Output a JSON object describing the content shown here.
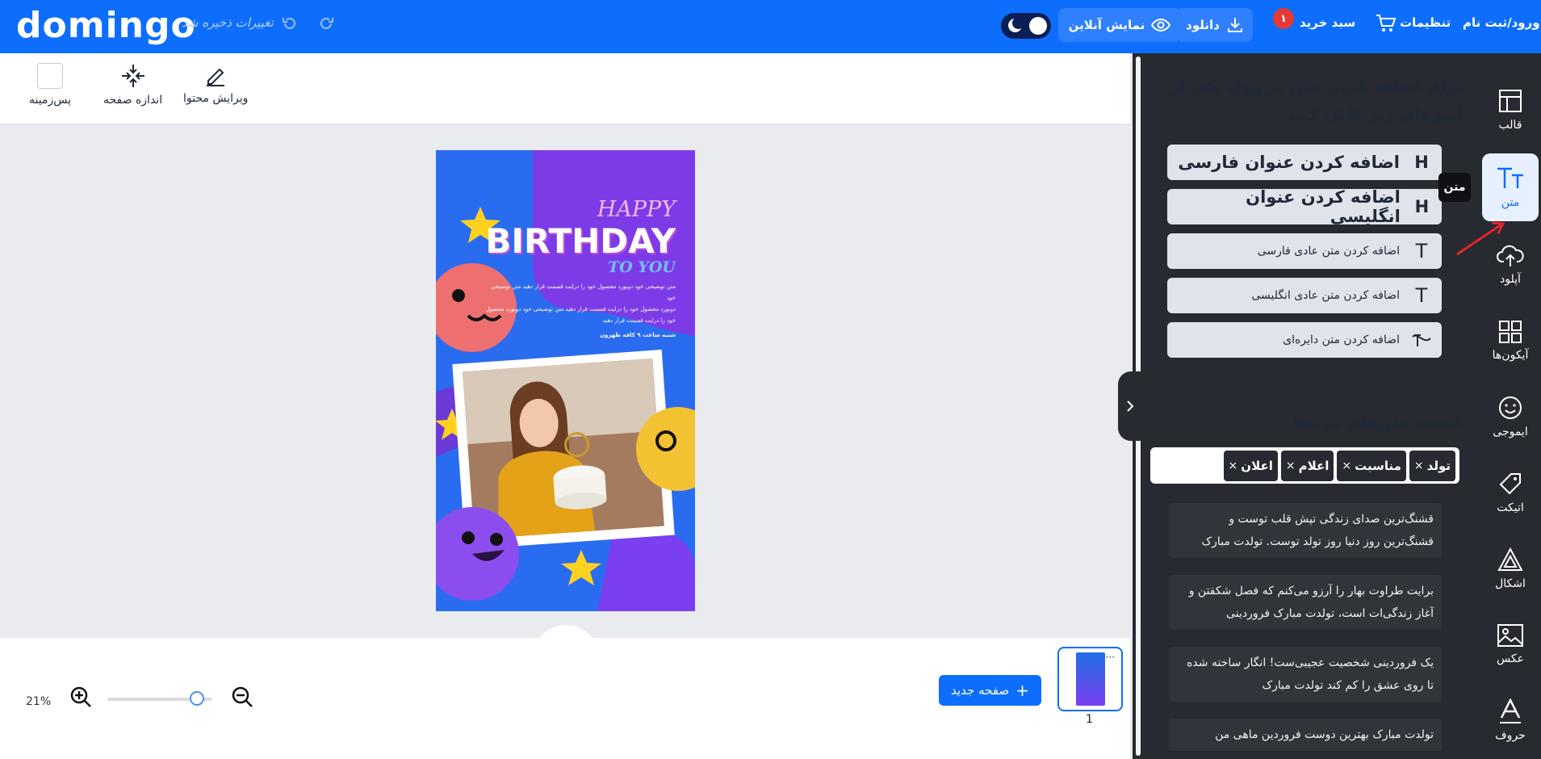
{
  "header": {
    "logo": "domingo",
    "saved_status": "تغییرات ذخیره شد",
    "preview_label": "نمایش آنلاین",
    "download_label": "دانلود",
    "cart_label": "سبد خرید",
    "cart_count": "۱",
    "settings_label": "تنظیمات",
    "login_label": "ورود/ثبت نام"
  },
  "tools": {
    "edit_content": "ویرایش محتوا",
    "page_size": "اندازه صفحه",
    "background": "پس‌زمینه"
  },
  "poster": {
    "happy": "HAPPY",
    "birthday": "BIRTHDAY",
    "to_you": "TO YOU",
    "body_lines": [
      "متن توضیحی خود دوبورد محصول خود را درایت قسمت قرار دهید متن توضیحی خود",
      "دوبورد محصول خود را درایت قسمت قرار دهید متن توضیحی خود دوبورد محصول",
      "خود را درایت قسمت قرار دهید"
    ],
    "footer_line": "شنبه ساعت ۹ کافه ظهرون"
  },
  "bottom": {
    "zoom": "21%",
    "zoom_level": 0.85,
    "new_page_label": "صفحه جدید",
    "page_number": "1"
  },
  "panel": {
    "instruction": "برای اضافه کردن متن بر روی یکی از آیتم‌های زیر کلیک کنید",
    "add_buttons": [
      {
        "label": "اضافه کردن عنوان فارسی",
        "icon": "heading-icon"
      },
      {
        "label": "اضافه کردن عنوان انگلیسی",
        "icon": "heading-icon"
      },
      {
        "label": "اضافه کردن متن عادی فارسی",
        "icon": "text-icon"
      },
      {
        "label": "اضافه کردن متن عادی انگلیسی",
        "icon": "text-icon"
      },
      {
        "label": "اضافه کردن متن دایره‌ای",
        "icon": "curve-text-icon"
      }
    ],
    "related_title": "لیست متن‌های مرتبط",
    "tags": [
      "تولد",
      "مناسبت",
      "اعلام",
      "اعلان"
    ],
    "snippets": [
      "قشنگ‌ترین صدای زندگی تپش قلب توست و قشنگ‌ترین روز دنیا روز تولد توست. تولدت مبارک",
      "برایت طراوت بهار را آرزو می‌کنم که فصل شکفتن و آغاز زندگی‌ات است، تولدت مبارک فروردینی",
      "یک فروردینی شخصیت عجیبی‌ست! انگار ساخته شده تا روی عشق را کم کند تولدت مبارک",
      "تولدت مبارک بهترین دوست فروردین ماهی من"
    ]
  },
  "rail": {
    "items": [
      {
        "label": "قالب",
        "icon": "template-icon"
      },
      {
        "label": "متن",
        "icon": "text-tt-icon"
      },
      {
        "label": "آپلود",
        "icon": "upload-icon"
      },
      {
        "label": "آیکون‌ها",
        "icon": "grid-icon"
      },
      {
        "label": "ایموجی",
        "icon": "smile-icon"
      },
      {
        "label": "اتیکت",
        "icon": "tag-icon"
      },
      {
        "label": "اشکال",
        "icon": "shapes-icon"
      },
      {
        "label": "عکس",
        "icon": "image-icon"
      },
      {
        "label": "حروف",
        "icon": "letter-icon"
      }
    ],
    "tooltip": "متن"
  },
  "colors": {
    "brand_blue": "#0d6efd",
    "panel_dark": "#272a30",
    "poster_purple": "#7b3ff0"
  }
}
